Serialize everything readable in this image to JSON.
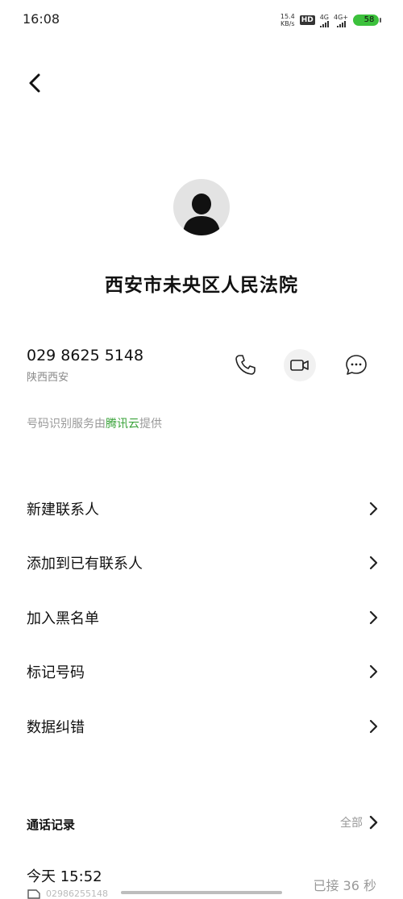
{
  "status_bar": {
    "time": "16:08",
    "net_speed_value": "15.4",
    "net_speed_unit": "KB/s",
    "hd_label": "HD",
    "sim1_label": "4G",
    "sim2_label": "4G+",
    "battery": "58",
    "battery_color": "#3cc13c"
  },
  "contact": {
    "name": "西安市未央区人民法院",
    "phone": "029 8625 5148",
    "location": "陕西西安"
  },
  "provider": {
    "prefix": "号码识别服务由",
    "brand": "腾讯云",
    "suffix": "提供",
    "brand_color": "#3aa33a"
  },
  "actions": {
    "call_icon": "phone-icon",
    "video_icon": "video-camera-icon",
    "message_icon": "message-bubble-icon"
  },
  "menu": [
    {
      "label": "新建联系人"
    },
    {
      "label": "添加到已有联系人"
    },
    {
      "label": "加入黑名单"
    },
    {
      "label": "标记号码"
    },
    {
      "label": "数据纠错"
    }
  ],
  "call_log": {
    "title": "通话记录",
    "all_label": "全部",
    "entries": [
      {
        "time": "今天 15:52",
        "status": "已接 36 秒",
        "number": "02986255148"
      }
    ]
  }
}
